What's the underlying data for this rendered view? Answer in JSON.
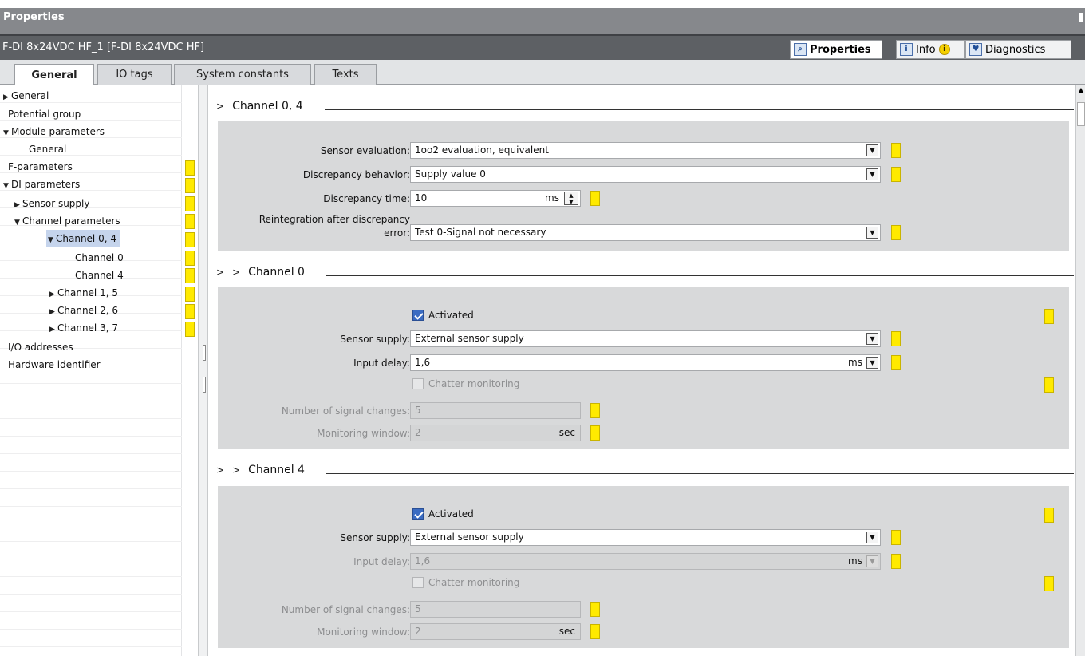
{
  "window": {
    "title": "Properties"
  },
  "module": {
    "name": "F-DI 8x24VDC HF_1 [F-DI 8x24VDC HF]"
  },
  "top_tabs": {
    "properties": "Properties",
    "info": "Info",
    "diagnostics": "Diagnostics"
  },
  "tabs": [
    "General",
    "IO tags",
    "System constants",
    "Texts"
  ],
  "tree": [
    "General",
    "Potential group",
    "Module parameters",
    "General",
    "F-parameters",
    "DI parameters",
    "Sensor supply",
    "Channel parameters",
    "Channel 0, 4",
    "Channel 0",
    "Channel 4",
    "Channel 1, 5",
    "Channel 2, 6",
    "Channel 3, 7",
    "I/O addresses",
    "Hardware identifier"
  ],
  "sec04": {
    "title": "Channel 0, 4",
    "sensor_evaluation_label": "Sensor evaluation:",
    "sensor_evaluation_value": "1oo2 evaluation, equivalent",
    "discrepancy_behavior_label": "Discrepancy behavior:",
    "discrepancy_behavior_value": "Supply value 0",
    "discrepancy_time_label": "Discrepancy time:",
    "discrepancy_time_value": "10",
    "discrepancy_time_unit": "ms",
    "reint_label_1": "Reintegration after discrepancy",
    "reint_label_2": "error:",
    "reint_value": "Test 0-Signal not necessary"
  },
  "sec0": {
    "title": "Channel 0",
    "activated": "Activated",
    "sensor_supply_label": "Sensor supply:",
    "sensor_supply_value": "External sensor supply",
    "input_delay_label": "Input delay:",
    "input_delay_value": "1,6",
    "input_delay_unit": "ms",
    "chatter": "Chatter monitoring",
    "signal_changes_label": "Number of signal changes:",
    "signal_changes_value": "5",
    "monitoring_window_label": "Monitoring window:",
    "monitoring_window_value": "2",
    "monitoring_window_unit": "sec"
  },
  "sec4": {
    "title": "Channel 4",
    "activated": "Activated",
    "sensor_supply_label": "Sensor supply:",
    "sensor_supply_value": "External sensor supply",
    "input_delay_label": "Input delay:",
    "input_delay_value": "1,6",
    "input_delay_unit": "ms",
    "chatter": "Chatter monitoring",
    "signal_changes_label": "Number of signal changes:",
    "signal_changes_value": "5",
    "monitoring_window_label": "Monitoring window:",
    "monitoring_window_value": "2",
    "monitoring_window_unit": "sec"
  },
  "colors": {
    "marker": "#ffea00",
    "selection": "#c5d4ec",
    "panel": "#d8d9da"
  }
}
